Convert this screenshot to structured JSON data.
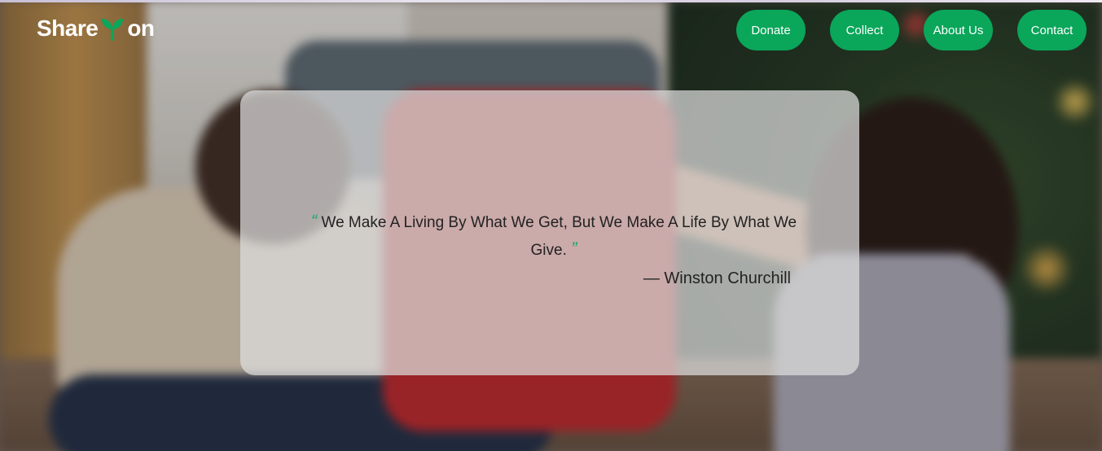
{
  "brand": {
    "name_part1": "Share",
    "name_part2": "on",
    "accent_color": "#0aa65a"
  },
  "nav": {
    "items": [
      {
        "label": "Donate"
      },
      {
        "label": "Collect"
      },
      {
        "label": "About Us"
      },
      {
        "label": "Contact"
      }
    ]
  },
  "hero": {
    "quote": {
      "open_mark": "“",
      "text": "We Make A Living By What We Get, But We Make A Life By What We Give.",
      "close_mark": "”",
      "author": "— Winston Churchill"
    }
  }
}
